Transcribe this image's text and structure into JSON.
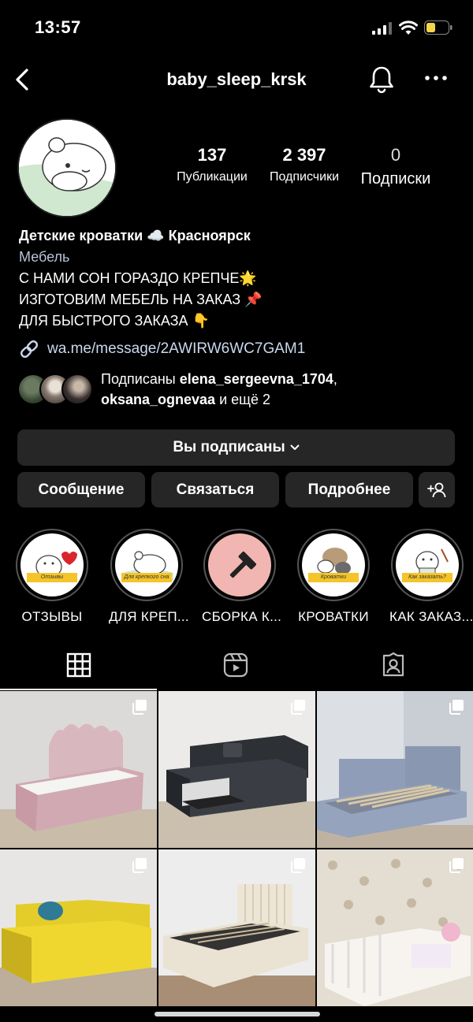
{
  "status_bar": {
    "time": "13:57"
  },
  "nav": {
    "title": "baby_sleep_krsk"
  },
  "profile": {
    "stats": [
      {
        "value": "137",
        "label": "Публикации"
      },
      {
        "value": "2 397",
        "label": "Подписчики"
      },
      {
        "value": "0",
        "label": "Подписки"
      }
    ],
    "name": "Детские кроватки ☁️ Красноярск",
    "category": "Мебель",
    "bio_lines": [
      "С НАМИ СОН ГОРАЗДО КРЕПЧЕ🌟",
      "ИЗГОТОВИМ МЕБЕЛЬ НА ЗАКАЗ 📌",
      "ДЛЯ БЫСТРОГО ЗАКАЗА 👇"
    ],
    "link": "wa.me/message/2AWIRW6WC7GAM1",
    "followed_by": {
      "prefix": "Подписаны ",
      "user1": "elena_sergeevna_1704",
      "sep": ",",
      "user2": "oksana_ognevaa",
      "suffix": " и ещё 2"
    }
  },
  "buttons": {
    "following": "Вы подписаны",
    "message": "Сообщение",
    "contact": "Связаться",
    "more": "Подробнее"
  },
  "highlights": [
    {
      "label": "ОТЗЫВЫ",
      "tag": "Отзывы"
    },
    {
      "label": "ДЛЯ КРЕП...",
      "tag": "Для крепкого сна"
    },
    {
      "label": "СБОРКА К...",
      "tag": ""
    },
    {
      "label": "КРОВАТКИ",
      "tag": "Кроватки"
    },
    {
      "label": "КАК ЗАКАЗ...",
      "tag": "Как заказать?"
    }
  ],
  "colors": {
    "background": "#000000",
    "button": "#262626",
    "link": "#c9d8ee",
    "category": "#b7c3d6",
    "battery": "#f5d547"
  },
  "icons": [
    "back-icon",
    "bell-icon",
    "more-icon",
    "link-icon",
    "chevron-down-icon",
    "add-user-icon",
    "grid-icon",
    "reels-icon",
    "tagged-icon",
    "multiple-photos-icon"
  ]
}
